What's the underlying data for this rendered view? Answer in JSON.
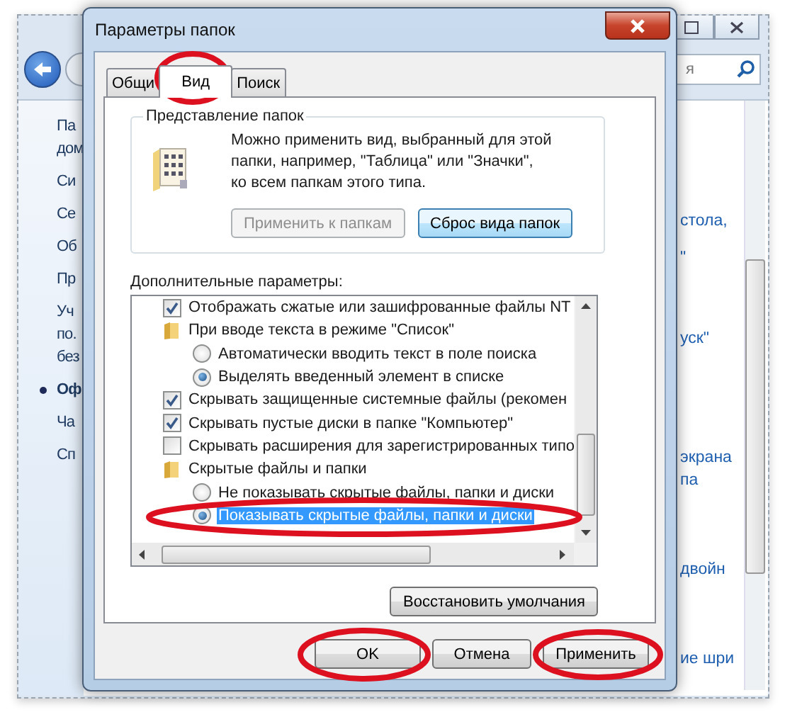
{
  "background_window": {
    "search": {
      "placeholder": "я"
    },
    "left_items": [
      {
        "lines": [
          "Па",
          "дом"
        ],
        "selected": false
      },
      {
        "lines": [
          "Си"
        ],
        "selected": false
      },
      {
        "lines": [
          "Се"
        ],
        "selected": false
      },
      {
        "lines": [
          "Об"
        ],
        "selected": false
      },
      {
        "lines": [
          "Пр"
        ],
        "selected": false
      },
      {
        "lines": [
          "Уч",
          "по.",
          "без"
        ],
        "selected": false
      },
      {
        "lines": [
          "Оф"
        ],
        "selected": true
      },
      {
        "lines": [
          "Ча"
        ],
        "selected": false
      },
      {
        "lines": [
          "Сп"
        ],
        "selected": false
      }
    ],
    "right_fragments": [
      "стола,",
      "\"",
      "уск\"",
      "экрана",
      "па",
      "двойн",
      "ие шри"
    ]
  },
  "dialog": {
    "title": "Параметры папок",
    "tabs": [
      {
        "label": "Общи",
        "selected": false
      },
      {
        "label": "Вид",
        "selected": true
      },
      {
        "label": "Поиск",
        "selected": false
      }
    ],
    "folder_views": {
      "legend": "Представление папок",
      "description_lines": [
        "Можно применить вид, выбранный для этой",
        "папки, например, \"Таблица\" или \"Значки\",",
        "ко всем папкам этого типа."
      ],
      "buttons": [
        {
          "label": "Применить к папкам",
          "disabled": true
        },
        {
          "label": "Сброс вида папок",
          "disabled": false
        }
      ]
    },
    "advanced": {
      "label": "Дополнительные параметры:",
      "items": [
        {
          "kind": "checkbox",
          "label": "Отображать сжатые или зашифрованные файлы NT",
          "checked": true,
          "highlighted": false
        },
        {
          "kind": "folder",
          "label": "При вводе текста в режиме \"Список\"",
          "highlighted": false,
          "children": [
            {
              "kind": "radio",
              "label": "Автоматически вводить текст в поле поиска",
              "selected": false,
              "highlighted": false
            },
            {
              "kind": "radio",
              "label": "Выделять введенный элемент в списке",
              "selected": true,
              "highlighted": false
            }
          ]
        },
        {
          "kind": "checkbox",
          "label": "Скрывать защищенные системные файлы (рекомен",
          "checked": true,
          "highlighted": false
        },
        {
          "kind": "checkbox",
          "label": "Скрывать пустые диски в папке \"Компьютер\"",
          "checked": true,
          "highlighted": false
        },
        {
          "kind": "checkbox",
          "label": "Скрывать расширения для зарегистрированных типо",
          "checked": false,
          "highlighted": false
        },
        {
          "kind": "folder",
          "label": "Скрытые файлы и папки",
          "highlighted": false,
          "children": [
            {
              "kind": "radio",
              "label": "Не показывать скрытые файлы, папки и диски",
              "selected": false,
              "highlighted": false
            },
            {
              "kind": "radio",
              "label": "Показывать скрытые файлы, папки и диски",
              "selected": true,
              "highlighted": true
            }
          ]
        }
      ]
    },
    "restore_button": "Восстановить умолчания",
    "buttons": [
      "OK",
      "Отмена",
      "Применить"
    ]
  }
}
